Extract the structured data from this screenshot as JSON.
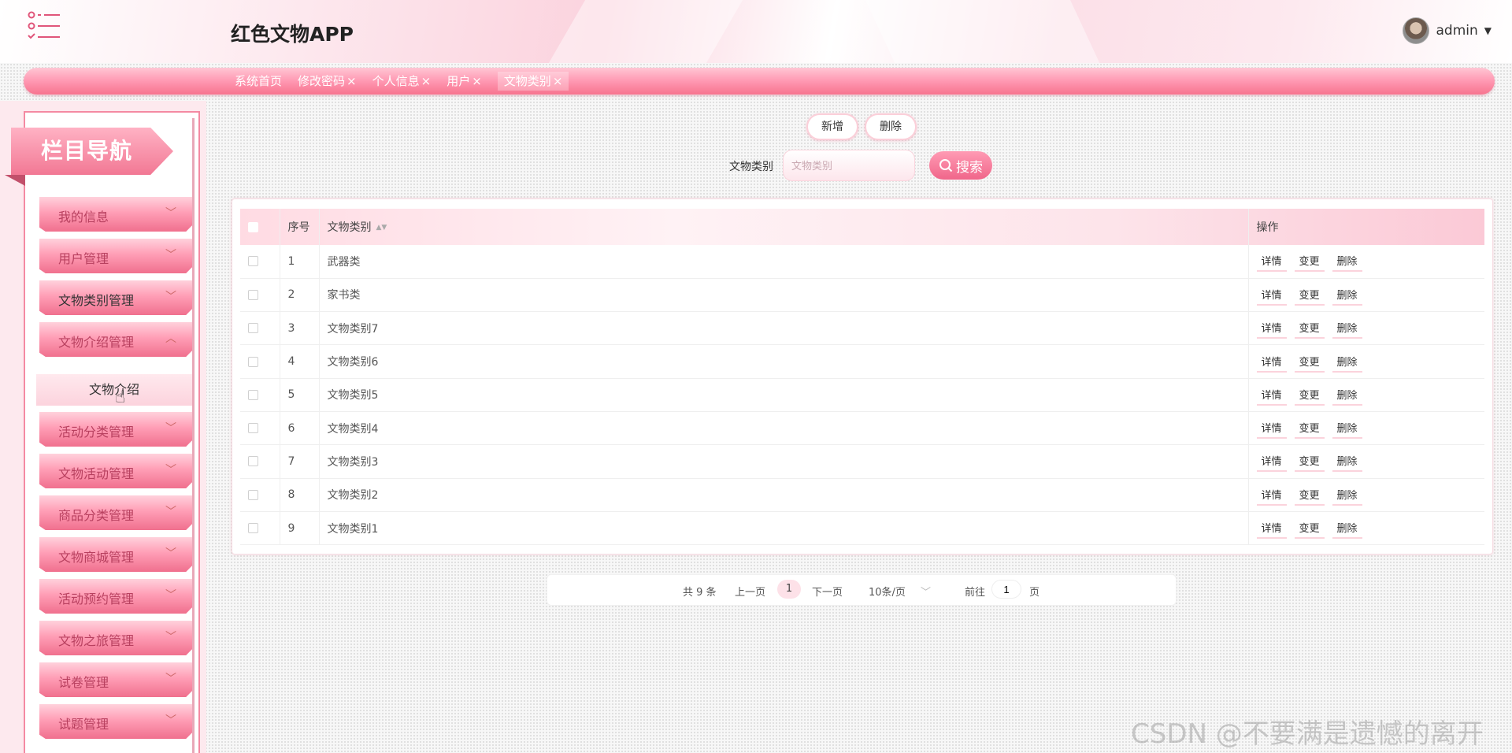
{
  "header": {
    "app_title": "红色文物APP",
    "username": "admin",
    "menu_icon": "menu-list-icon",
    "caret": "▼"
  },
  "tabs": [
    {
      "label": "系统首页",
      "closable": false
    },
    {
      "label": "修改密码",
      "closable": true
    },
    {
      "label": "个人信息",
      "closable": true
    },
    {
      "label": "用户",
      "closable": true
    },
    {
      "label": "文物类别",
      "closable": true,
      "active": true
    }
  ],
  "tab_close_glyph": "×",
  "sidebar": {
    "banner": "栏目导航",
    "items": [
      {
        "label": "我的信息",
        "chevron": "﹀"
      },
      {
        "label": "用户管理",
        "chevron": "﹀"
      },
      {
        "label": "文物类别管理",
        "chevron": "﹀"
      },
      {
        "label": "文物介绍管理",
        "chevron": "︿"
      },
      {
        "label": "活动分类管理",
        "chevron": "﹀"
      },
      {
        "label": "文物活动管理",
        "chevron": "﹀"
      },
      {
        "label": "商品分类管理",
        "chevron": "﹀"
      },
      {
        "label": "文物商城管理",
        "chevron": "﹀"
      },
      {
        "label": "活动预约管理",
        "chevron": "﹀"
      },
      {
        "label": "文物之旅管理",
        "chevron": "﹀"
      },
      {
        "label": "试卷管理",
        "chevron": "﹀"
      },
      {
        "label": "试题管理",
        "chevron": "﹀"
      }
    ],
    "submenu_item": "文物介绍"
  },
  "toolbar": {
    "add_label": "新增",
    "delete_label": "删除",
    "search_label": "文物类别",
    "search_placeholder": "文物类别",
    "search_value": "",
    "search_button": "搜索"
  },
  "table": {
    "headers": {
      "index": "序号",
      "category": "文物类别",
      "actions": "操作"
    },
    "sort_glyph": "▲▼",
    "action_labels": {
      "detail": "详情",
      "edit": "变更",
      "delete": "删除"
    },
    "rows": [
      {
        "index": "1",
        "category": "武器类"
      },
      {
        "index": "2",
        "category": "家书类"
      },
      {
        "index": "3",
        "category": "文物类别7"
      },
      {
        "index": "4",
        "category": "文物类别6"
      },
      {
        "index": "5",
        "category": "文物类别5"
      },
      {
        "index": "6",
        "category": "文物类别4"
      },
      {
        "index": "7",
        "category": "文物类别3"
      },
      {
        "index": "8",
        "category": "文物类别2"
      },
      {
        "index": "9",
        "category": "文物类别1"
      }
    ]
  },
  "pagination": {
    "total": "共 9 条",
    "prev": "上一页",
    "current_page": "1",
    "next": "下一页",
    "page_size": "10条/页",
    "size_caret": "﹀",
    "goto_label": "前往",
    "goto_value": "1",
    "page_suffix": "页"
  },
  "watermark": "CSDN @不要满是遗憾的离开",
  "colors": {
    "accent": "#f0668a",
    "accent_light": "#fde1e8",
    "banner": "#f27894"
  }
}
